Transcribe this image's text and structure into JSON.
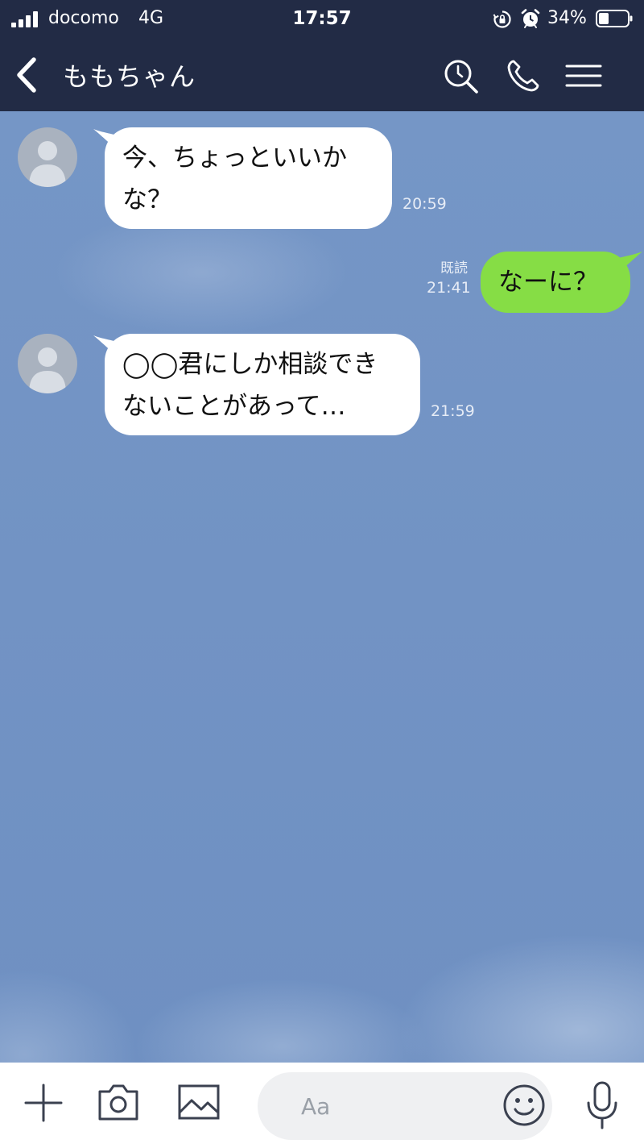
{
  "status_bar": {
    "carrier": "docomo",
    "network": "4G",
    "time": "17:57",
    "battery_percent": "34%",
    "icons": [
      "signal-icon",
      "rotation-lock-icon",
      "alarm-icon",
      "battery-icon"
    ]
  },
  "header": {
    "title": "ももちゃん",
    "icons": [
      "back-icon",
      "search-icon",
      "phone-icon",
      "menu-icon"
    ]
  },
  "messages": [
    {
      "direction": "received",
      "lines": [
        "今、ちょっといいか",
        "な？"
      ],
      "time": "20:59"
    },
    {
      "direction": "sent",
      "lines": [
        "なーに？"
      ],
      "time": "21:41",
      "read": "既読"
    },
    {
      "direction": "received",
      "lines": [
        "◯◯君にしか相談でき",
        "ないことがあって…"
      ],
      "time": "21:59"
    }
  ],
  "input_bar": {
    "placeholder": "Aa",
    "icons": [
      "plus-icon",
      "camera-icon",
      "image-icon",
      "emoji-icon",
      "mic-icon"
    ]
  },
  "colors": {
    "header_bg": "#222b45",
    "chat_bg": "#7093c4",
    "sent_bubble": "#86dd45",
    "received_bubble": "#ffffff"
  }
}
